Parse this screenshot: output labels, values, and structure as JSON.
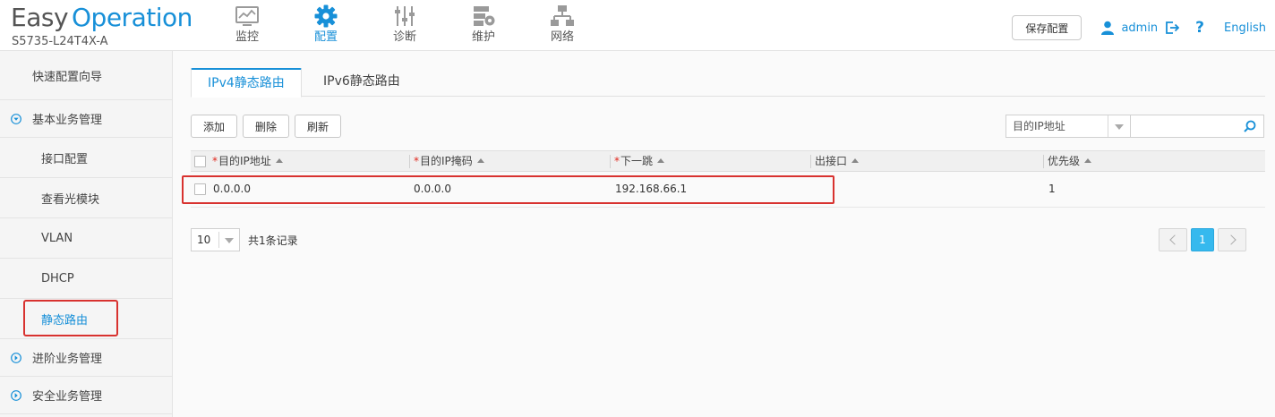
{
  "header": {
    "logo_easy": "Easy",
    "logo_operation": "Operation",
    "model": "S5735-L24T4X-A",
    "nav": [
      {
        "label": "监控",
        "icon": "monitor-icon"
      },
      {
        "label": "配置",
        "icon": "gear-icon",
        "active": true
      },
      {
        "label": "诊断",
        "icon": "sliders-icon"
      },
      {
        "label": "维护",
        "icon": "server-gear-icon"
      },
      {
        "label": "网络",
        "icon": "network-icon"
      }
    ],
    "save_label": "保存配置",
    "user": "admin",
    "help": "?",
    "language": "English",
    "accent_color": "#1890d8"
  },
  "sidebar": {
    "items": [
      {
        "label": "快速配置向导",
        "kind": "top"
      },
      {
        "label": "基本业务管理",
        "kind": "group",
        "expanded": true
      },
      {
        "label": "接口配置",
        "kind": "sub"
      },
      {
        "label": "查看光模块",
        "kind": "sub"
      },
      {
        "label": "VLAN",
        "kind": "sub"
      },
      {
        "label": "DHCP",
        "kind": "sub"
      },
      {
        "label": "静态路由",
        "kind": "sub",
        "active": true
      },
      {
        "label": "进阶业务管理",
        "kind": "group",
        "expanded": false
      },
      {
        "label": "安全业务管理",
        "kind": "group",
        "expanded": false
      }
    ]
  },
  "main": {
    "tabs": [
      {
        "label": "IPv4静态路由",
        "active": true
      },
      {
        "label": "IPv6静态路由",
        "active": false
      }
    ],
    "toolbar": {
      "add": "添加",
      "delete": "删除",
      "refresh": "刷新"
    },
    "search": {
      "field": "目的IP地址",
      "value": ""
    },
    "table": {
      "columns": [
        {
          "label": "目的IP地址",
          "required": true
        },
        {
          "label": "目的IP掩码",
          "required": true
        },
        {
          "label": "下一跳",
          "required": true
        },
        {
          "label": "出接口",
          "required": false
        },
        {
          "label": "优先级",
          "required": false
        }
      ],
      "rows": [
        {
          "dest_ip": "0.0.0.0",
          "mask": "0.0.0.0",
          "next_hop": "192.168.66.1",
          "out_if": "",
          "priority": "1"
        }
      ]
    },
    "pager": {
      "page_size": "10",
      "total": "共1条记录",
      "current_page": "1"
    }
  }
}
